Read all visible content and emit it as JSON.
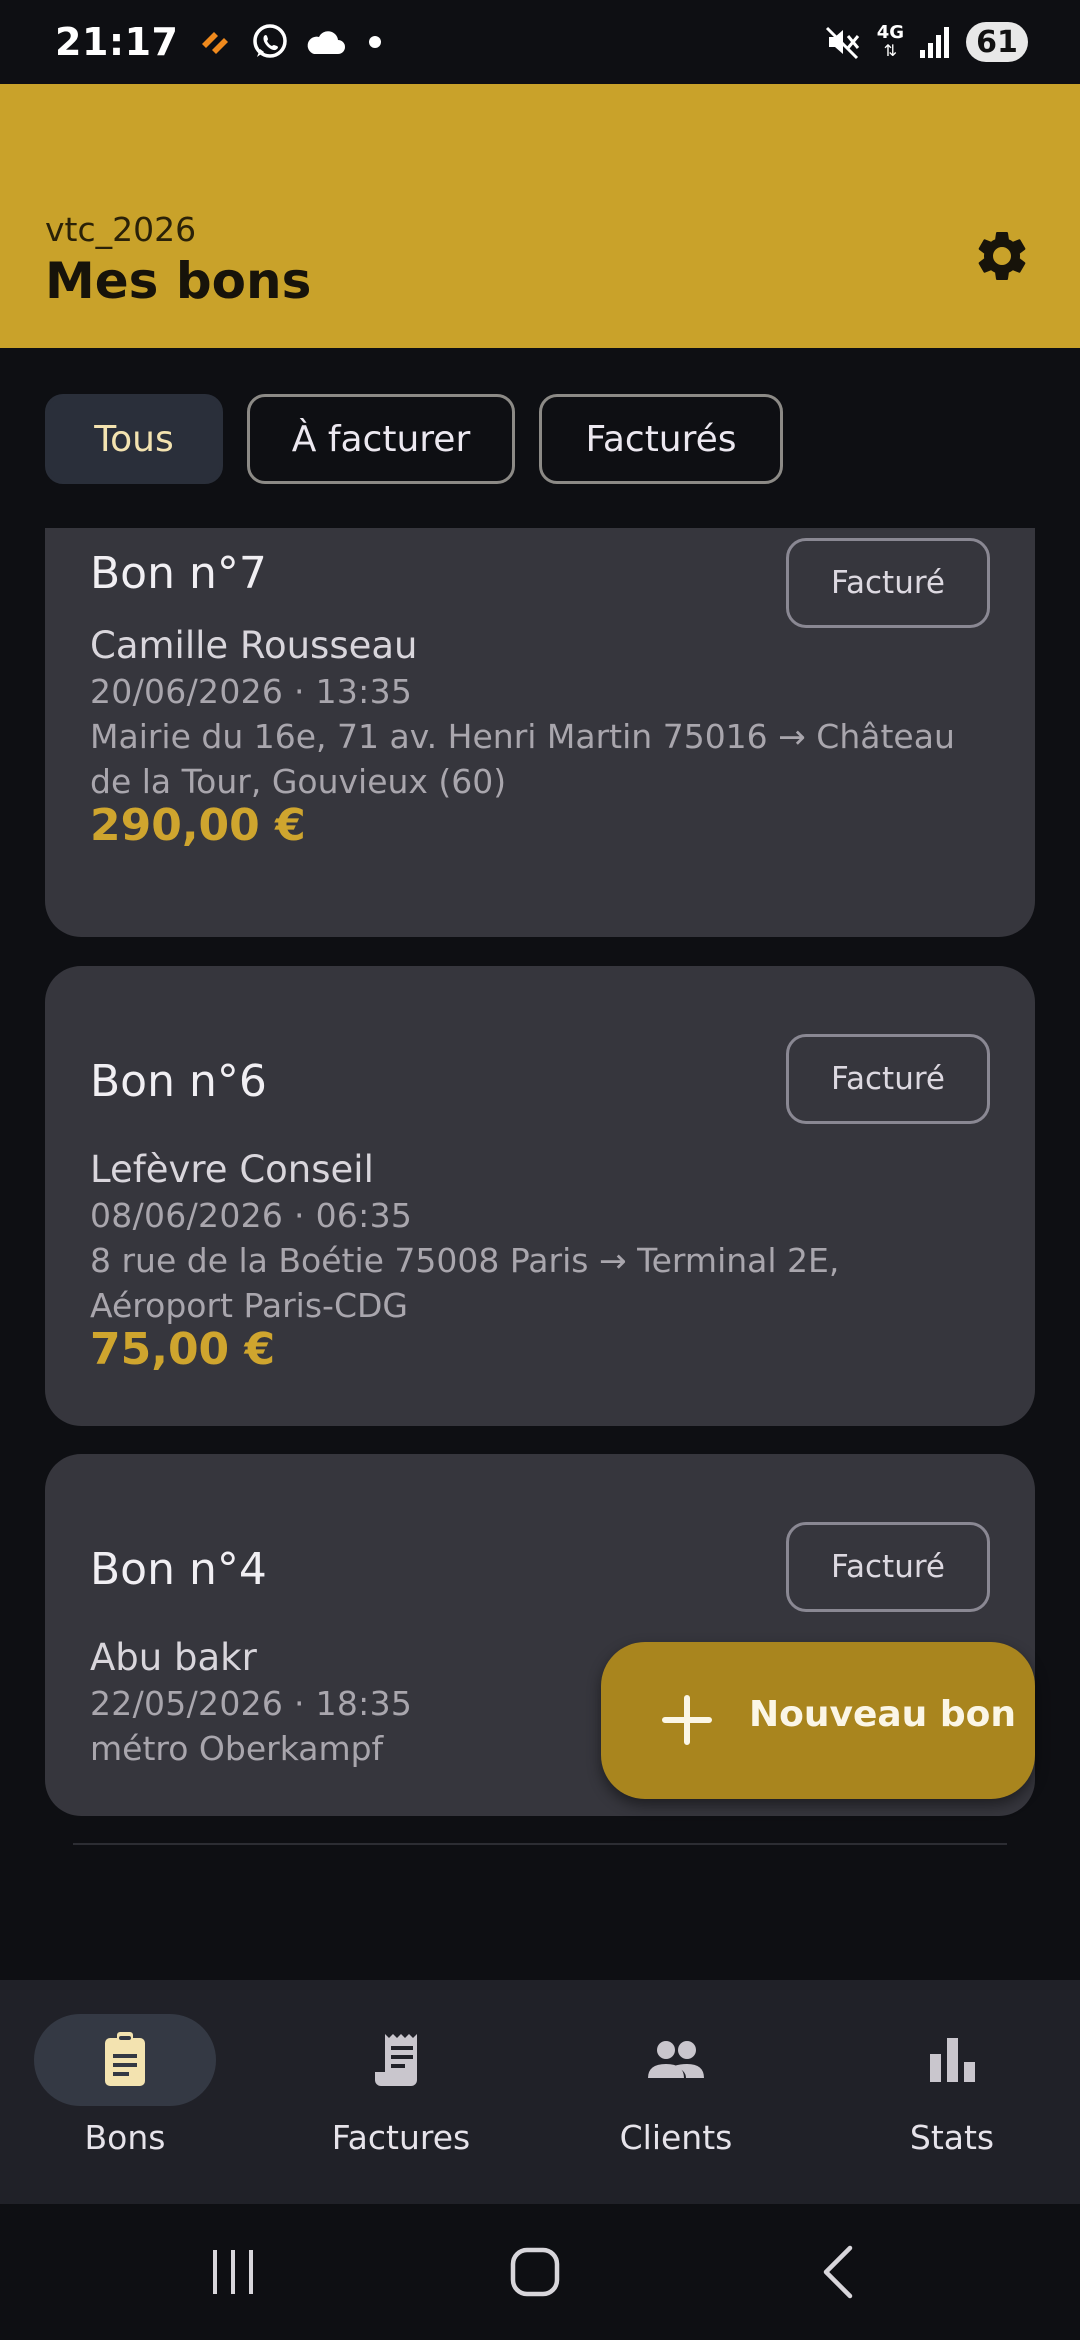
{
  "status_bar": {
    "time": "21:17",
    "network": "4G",
    "battery": "61",
    "left_icons": [
      "app-notification-icon",
      "whatsapp-icon",
      "cloud-icon",
      "dot-icon"
    ],
    "right_icons": [
      "mute-icon",
      "network-4g-icon",
      "signal-icon"
    ]
  },
  "header": {
    "subtitle": "vtc_2026",
    "title": "Mes bons",
    "settings_icon": "gear-icon",
    "color": "#c9a22a"
  },
  "filters": [
    {
      "label": "Tous",
      "active": true
    },
    {
      "label": "À facturer",
      "active": false
    },
    {
      "label": "Facturés",
      "active": false
    }
  ],
  "cards": [
    {
      "number": "Bon n°7",
      "status": "Facturé",
      "client": "Camille Rousseau",
      "datetime": "20/06/2026 · 13:35",
      "route": "Mairie du 16e, 71 av. Henri Martin 75016 → Château de la Tour, Gouvieux (60)",
      "amount": "290,00 €"
    },
    {
      "number": "Bon n°6",
      "status": "Facturé",
      "client": "Lefèvre Conseil",
      "datetime": "08/06/2026 · 06:35",
      "route": "8 rue de la Boétie 75008 Paris → Terminal 2E, Aéroport Paris-CDG",
      "amount": "75,00 €"
    },
    {
      "number": "Bon n°4",
      "status": "Facturé",
      "client": "Abu bakr",
      "datetime": "22/05/2026 · 18:35",
      "route": "métro Oberkampf"
    }
  ],
  "fab": {
    "label": "Nouveau bon",
    "icon": "plus-icon"
  },
  "bottom_nav": [
    {
      "label": "Bons",
      "icon": "clipboard-icon",
      "active": true
    },
    {
      "label": "Factures",
      "icon": "receipt-icon",
      "active": false
    },
    {
      "label": "Clients",
      "icon": "people-icon",
      "active": false
    },
    {
      "label": "Stats",
      "icon": "bar-chart-icon",
      "active": false
    }
  ],
  "system_nav": [
    "recents-icon",
    "home-icon",
    "back-icon"
  ],
  "colors": {
    "accent": "#c9a22a",
    "amount": "#cfa52e",
    "fab": "#a9851e",
    "card": "#36363d",
    "background": "#0e0f13"
  }
}
